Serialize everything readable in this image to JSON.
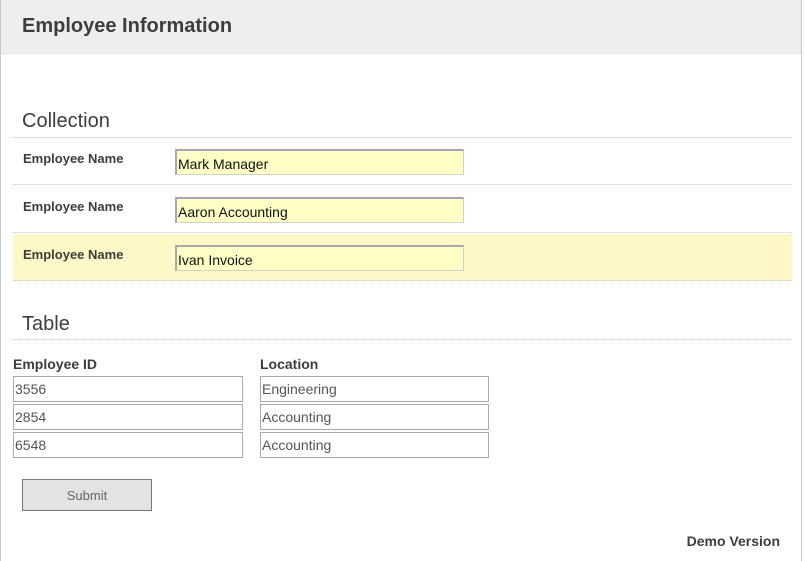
{
  "header": {
    "title": "Employee Information"
  },
  "collection": {
    "title": "Collection",
    "rows": [
      {
        "label": "Employee Name",
        "value": "Mark Manager"
      },
      {
        "label": "Employee Name",
        "value": "Aaron Accounting"
      },
      {
        "label": "Employee Name",
        "value": "Ivan Invoice"
      }
    ],
    "selected_row": 3
  },
  "table": {
    "title": "Table",
    "columns": [
      "Employee ID",
      "Location"
    ],
    "rows": [
      [
        "3556",
        "Engineering"
      ],
      [
        "2854",
        "Accounting"
      ],
      [
        "6548",
        "Accounting"
      ]
    ]
  },
  "submit": {
    "label": "Submit"
  },
  "footer": {
    "demo": "Demo Version"
  },
  "colors": {
    "header_bg": "#eeeeee",
    "input_bg": "#ffffc6",
    "selected_row_bg": "#fdf8c5"
  }
}
